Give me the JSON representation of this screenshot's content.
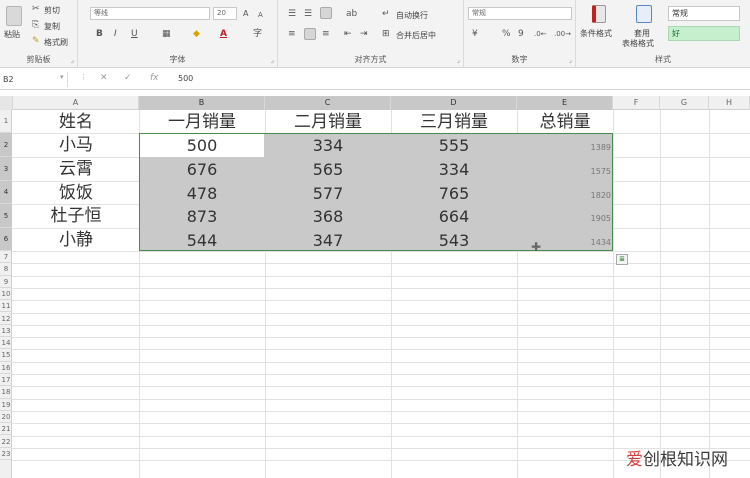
{
  "ribbon": {
    "clipboard": {
      "paste": "粘贴",
      "cut": "剪切",
      "copy": "复制",
      "format_painter": "格式刷",
      "label": "剪贴板"
    },
    "font": {
      "name": "等线",
      "size": "20",
      "bold": "B",
      "italic": "I",
      "underline": "U",
      "font_color": "A",
      "label": "字体"
    },
    "alignment": {
      "wrap": "自动换行",
      "merge": "合并后居中",
      "label": "对齐方式"
    },
    "number": {
      "format": "常规",
      "percent": "%",
      "comma": "9",
      "label": "数字"
    },
    "styles": {
      "conditional": "条件格式",
      "table_format_1": "套用",
      "table_format_2": "表格格式",
      "normal": "常规",
      "good": "好",
      "label": "样式"
    }
  },
  "formula_bar": {
    "name_box": "B2",
    "fx": "fx",
    "cancel": "✕",
    "enter": "✓",
    "value": "500"
  },
  "columns": [
    "A",
    "B",
    "C",
    "D",
    "E",
    "F",
    "G",
    "H"
  ],
  "rows": [
    "1",
    "2",
    "3",
    "4",
    "5",
    "6",
    "7",
    "8",
    "9",
    "10",
    "11",
    "12",
    "13",
    "14",
    "15",
    "16",
    "17",
    "18",
    "19",
    "20",
    "21",
    "22",
    "23"
  ],
  "table": {
    "headers": [
      "姓名",
      "一月销量",
      "二月销量",
      "三月销量",
      "总销量"
    ],
    "rows": [
      [
        "小马",
        "500",
        "334",
        "555",
        "1389"
      ],
      [
        "云霄",
        "676",
        "565",
        "334",
        "1575"
      ],
      [
        "饭饭",
        "478",
        "577",
        "765",
        "1820"
      ],
      [
        "杜子恒",
        "873",
        "368",
        "664",
        "1905"
      ],
      [
        "小静",
        "544",
        "347",
        "543",
        "1434"
      ]
    ]
  },
  "watermark": {
    "red": "爱",
    "rest": "创根知识网"
  },
  "colors": {
    "selection": "#c9c9c9",
    "selection_border": "#4a8a4a",
    "good_style": "#c6efce"
  }
}
